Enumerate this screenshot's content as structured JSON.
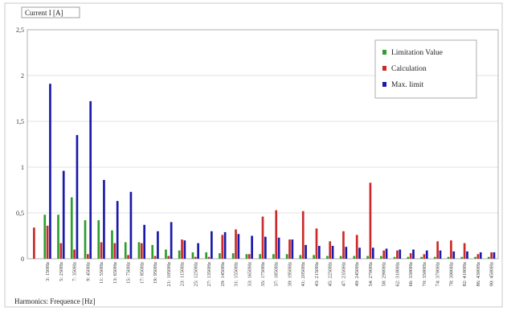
{
  "chart_data": {
    "type": "bar",
    "title": "",
    "ylabel": "Current I [A]",
    "xlabel": "Harmonics: Frequence [Hz]",
    "ylim": [
      0,
      2.5
    ],
    "yticks": [
      "0",
      "0,5",
      "1",
      "1,5",
      "2",
      "2,5"
    ],
    "grid": true,
    "legend_position": "top-right",
    "categories": [
      "",
      "3: 150Hz",
      "5: 250Hz",
      "7: 350Hz",
      "9: 450Hz",
      "11: 550Hz",
      "13: 650Hz",
      "15: 750Hz",
      "17: 850Hz",
      "19: 950Hz",
      "21: 1050Hz",
      "23: 1150Hz",
      "25: 1250Hz",
      "27: 1350Hz",
      "29: 1450Hz",
      "31: 1550Hz",
      "33: 1650Hz",
      "35: 1750Hz",
      "37: 1850Hz",
      "39: 1950Hz",
      "41: 2050Hz",
      "43: 2150Hz",
      "45: 2250Hz",
      "47: 2350Hz",
      "49: 2450Hz",
      "54: 2700Hz",
      "58: 2900Hz",
      "62: 3100Hz",
      "66: 3300Hz",
      "70: 3500Hz",
      "74: 3700Hz",
      "78: 3900Hz",
      "82: 4100Hz",
      "86: 4300Hz",
      "90: 4500Hz"
    ],
    "series": [
      {
        "name": "Limitation Value",
        "color": "#2e9e2e",
        "values": [
          0,
          0.48,
          0.48,
          0.67,
          0.42,
          0.42,
          0.31,
          0.18,
          0.18,
          0.15,
          0.1,
          0.09,
          0.07,
          0.07,
          0.06,
          0.06,
          0.05,
          0.05,
          0.05,
          0.05,
          0.04,
          0.04,
          0.03,
          0.03,
          0.03,
          0.03,
          0.03,
          0.02,
          0.02,
          0.02,
          0.02,
          0.02,
          0.02,
          0.02,
          0.02
        ]
      },
      {
        "name": "Calculation",
        "color": "#cc2a2a",
        "values": [
          0.34,
          0.36,
          0.17,
          0.1,
          0.05,
          0.18,
          0.17,
          0.04,
          0.17,
          0.03,
          0.03,
          0.21,
          0.02,
          0.02,
          0.26,
          0.32,
          0.05,
          0.46,
          0.53,
          0.21,
          0.52,
          0.33,
          0.19,
          0.3,
          0.26,
          0.83,
          0.09,
          0.09,
          0.06,
          0.05,
          0.19,
          0.2,
          0.17,
          0.05,
          0.07
        ]
      },
      {
        "name": "Max. limit",
        "color": "#1a1aa8",
        "values": [
          0,
          1.91,
          0.96,
          1.35,
          1.72,
          0.86,
          0.63,
          0.73,
          0.37,
          0.3,
          0.4,
          0.2,
          0.17,
          0.3,
          0.29,
          0.27,
          0.25,
          0.24,
          0.23,
          0.21,
          0.15,
          0.14,
          0.14,
          0.13,
          0.12,
          0.12,
          0.11,
          0.1,
          0.1,
          0.09,
          0.09,
          0.08,
          0.08,
          0.07,
          0.07
        ]
      }
    ]
  }
}
